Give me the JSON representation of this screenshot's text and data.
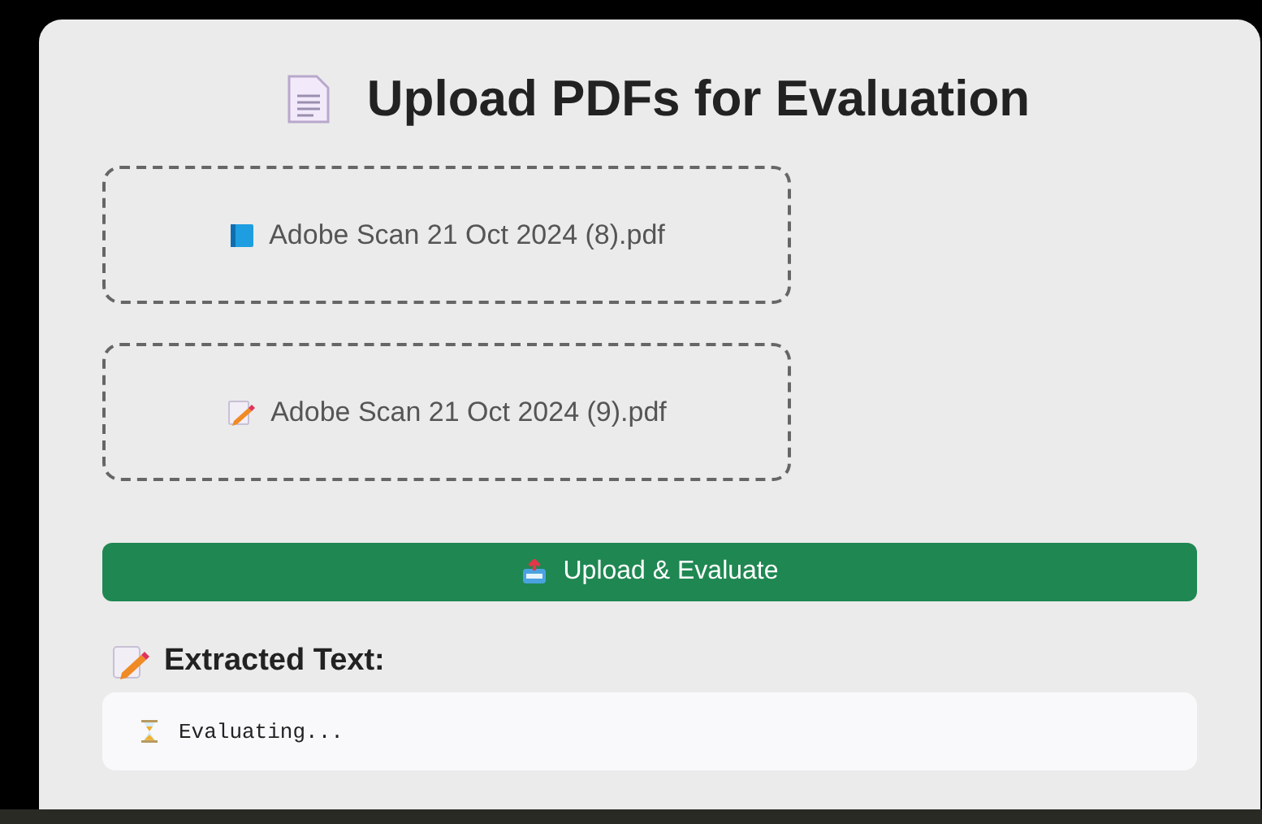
{
  "title": "Upload PDFs for Evaluation",
  "files": [
    {
      "name": "Adobe Scan 21 Oct 2024 (8).pdf",
      "kind": "book"
    },
    {
      "name": "Adobe Scan 21 Oct 2024 (9).pdf",
      "kind": "memo"
    }
  ],
  "upload_button": {
    "label": "Upload & Evaluate"
  },
  "result": {
    "heading": "Extracted Text:",
    "output": "Evaluating..."
  }
}
